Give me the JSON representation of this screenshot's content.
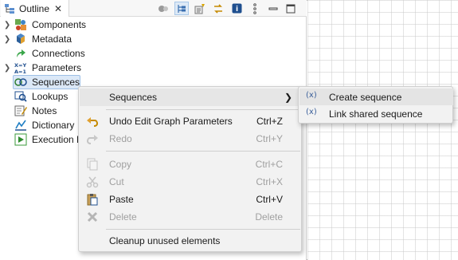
{
  "panel": {
    "tab_label": "Outline",
    "toolbar_icons": [
      "hide-icon",
      "tree-layout-icon",
      "filter-icon",
      "link-editor-icon",
      "info-icon",
      "view-menu-icon",
      "minimize-icon",
      "maximize-icon"
    ]
  },
  "tree": {
    "items": [
      {
        "label": "Components",
        "icon": "components-icon",
        "expandable": true
      },
      {
        "label": "Metadata",
        "icon": "metadata-icon",
        "expandable": true
      },
      {
        "label": "Connections",
        "icon": "connections-icon",
        "expandable": false
      },
      {
        "label": "Parameters",
        "icon": "parameters-icon",
        "expandable": true
      },
      {
        "label": "Sequences",
        "icon": "sequences-icon",
        "expandable": false,
        "selected": true
      },
      {
        "label": "Lookups",
        "icon": "lookups-icon",
        "expandable": false
      },
      {
        "label": "Notes",
        "icon": "notes-icon",
        "expandable": false
      },
      {
        "label": "Dictionary",
        "icon": "dictionary-icon",
        "expandable": false
      },
      {
        "label": "Execution P",
        "icon": "execution-icon",
        "expandable": false
      }
    ]
  },
  "context_menu": {
    "items": [
      {
        "label": "Sequences",
        "shortcut": "",
        "has_submenu": true,
        "enabled": true,
        "icon": ""
      },
      {
        "label": "Undo Edit Graph Parameters",
        "shortcut": "Ctrl+Z",
        "enabled": true,
        "icon": "undo-icon"
      },
      {
        "label": "Redo",
        "shortcut": "Ctrl+Y",
        "enabled": false,
        "icon": "redo-icon"
      },
      {
        "label": "Copy",
        "shortcut": "Ctrl+C",
        "enabled": false,
        "icon": "copy-icon"
      },
      {
        "label": "Cut",
        "shortcut": "Ctrl+X",
        "enabled": false,
        "icon": "cut-icon"
      },
      {
        "label": "Paste",
        "shortcut": "Ctrl+V",
        "enabled": true,
        "icon": "paste-icon"
      },
      {
        "label": "Delete",
        "shortcut": "Delete",
        "enabled": false,
        "icon": "delete-icon"
      },
      {
        "label": "Cleanup unused elements",
        "shortcut": "",
        "enabled": true,
        "icon": ""
      }
    ]
  },
  "submenu": {
    "items": [
      {
        "label": "Create sequence",
        "icon": "create-sequence-icon",
        "glyph": "(x)"
      },
      {
        "label": "Link shared sequence",
        "icon": "link-sequence-icon",
        "glyph": "(x)"
      }
    ]
  },
  "colors": {
    "selection": "#dbe8f7",
    "menu_bg": "#f2f2f2",
    "disabled_text": "#a0a0a0"
  }
}
